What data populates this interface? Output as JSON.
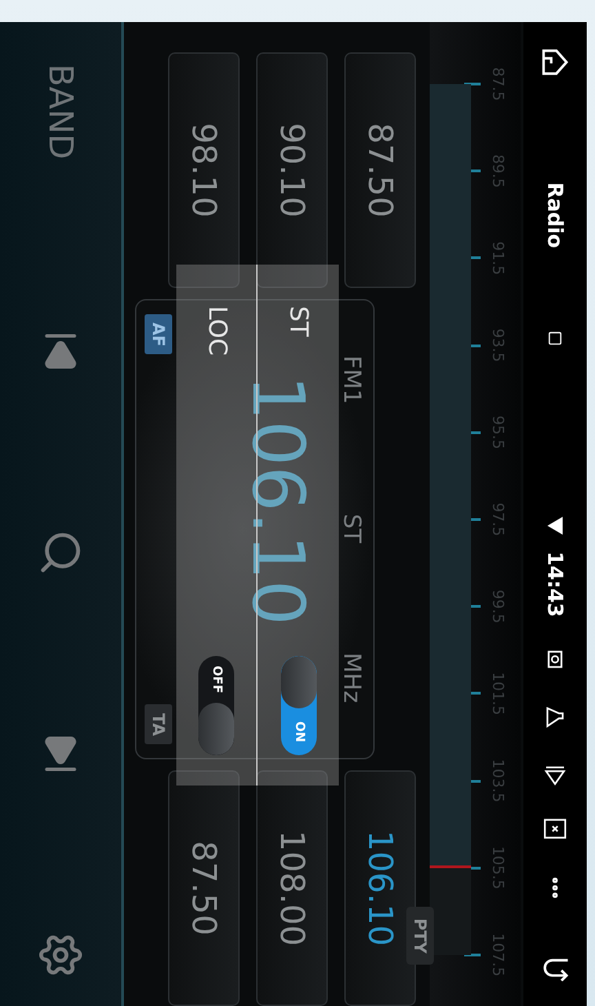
{
  "status_bar": {
    "title": "Radio",
    "time": "14:43"
  },
  "tuner": {
    "scale": [
      "87.5",
      "89.5",
      "91.5",
      "93.5",
      "95.5",
      "97.5",
      "99.5",
      "101.5",
      "103.5",
      "105.5",
      "107.5"
    ],
    "level": 0.9
  },
  "presets": [
    {
      "frequency": "87.50",
      "selected": false
    },
    {
      "frequency": "90.10",
      "selected": false
    },
    {
      "frequency": "98.10",
      "selected": false
    },
    {
      "frequency": "106.10",
      "selected": true
    },
    {
      "frequency": "108.00",
      "selected": false
    },
    {
      "frequency": "87.50",
      "selected": false
    }
  ],
  "pty": "PTY",
  "display": {
    "band": "FM1",
    "stereo": "ST",
    "unit": "MHz",
    "frequency": "106.10",
    "badges": [
      {
        "label": "AF",
        "on": true
      },
      {
        "label": "TA",
        "on": false
      }
    ]
  },
  "settings_popup": {
    "rows": [
      {
        "label": "ST",
        "on": true,
        "switch_text": "ON"
      },
      {
        "label": "LOC",
        "on": false,
        "switch_text": "OFF"
      }
    ]
  },
  "controls": {
    "band": "BAND"
  }
}
